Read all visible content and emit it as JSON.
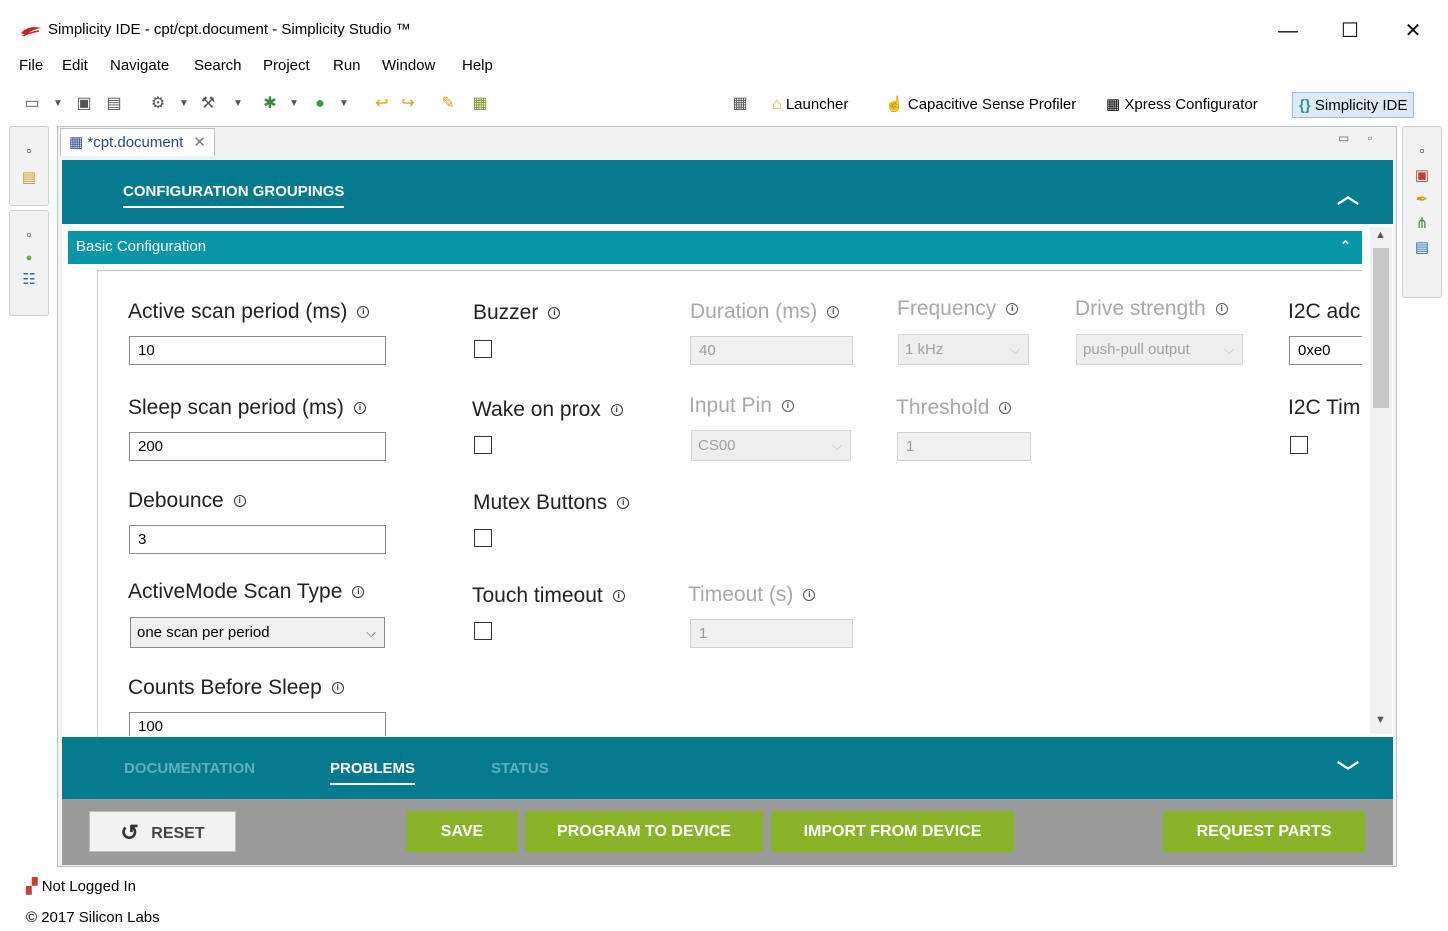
{
  "window": {
    "title": "Simplicity IDE - cpt/cpt.document - Simplicity Studio ™",
    "controls": {
      "minimize": "—",
      "maximize": "☐",
      "close": "✕"
    }
  },
  "menu": [
    "File",
    "Edit",
    "Navigate",
    "Search",
    "Project",
    "Run",
    "Window",
    "Help"
  ],
  "perspectives": {
    "launcher": "Launcher",
    "capsense": "Capacitive Sense Profiler",
    "xpress": "Xpress Configurator",
    "simplicity": "Simplicity IDE"
  },
  "editor": {
    "tab_label": "*cpt.document",
    "header_title": "CONFIGURATION GROUPINGS",
    "section_title": "Basic Configuration",
    "fields": {
      "active_scan_period": {
        "label": "Active scan period (ms)",
        "value": "10"
      },
      "sleep_scan_period": {
        "label": "Sleep scan period (ms)",
        "value": "200"
      },
      "debounce": {
        "label": "Debounce",
        "value": "3"
      },
      "activemode_scan_type": {
        "label": "ActiveMode Scan Type",
        "value": "one scan per period"
      },
      "counts_before_sleep": {
        "label": "Counts Before Sleep",
        "value": "100"
      },
      "buzzer": {
        "label": "Buzzer",
        "checked": false
      },
      "wake_on_prox": {
        "label": "Wake on prox",
        "checked": false
      },
      "mutex_buttons": {
        "label": "Mutex Buttons",
        "checked": false
      },
      "touch_timeout": {
        "label": "Touch timeout",
        "checked": false
      },
      "duration": {
        "label": "Duration (ms)",
        "value": "40"
      },
      "input_pin": {
        "label": "Input Pin",
        "value": "CS00"
      },
      "timeout": {
        "label": "Timeout (s)",
        "value": "1"
      },
      "frequency": {
        "label": "Frequency",
        "value": "1 kHz"
      },
      "threshold": {
        "label": "Threshold",
        "value": "1"
      },
      "drive_strength": {
        "label": "Drive strength",
        "value": "push-pull output"
      },
      "i2c_address": {
        "label": "I2C adc",
        "value": "0xe0"
      },
      "i2c_timeout": {
        "label": "I2C Tim",
        "checked": false
      }
    },
    "info_glyph": "i"
  },
  "footer_tabs": {
    "documentation": "DOCUMENTATION",
    "problems": "PROBLEMS",
    "status": "STATUS"
  },
  "actions": {
    "reset": "RESET",
    "save": "SAVE",
    "program": "PROGRAM TO DEVICE",
    "import": "IMPORT FROM DEVICE",
    "request": "REQUEST PARTS"
  },
  "status_bar": {
    "login": "Not Logged In",
    "copyright": "© 2017 Silicon Labs"
  },
  "colors": {
    "header_teal": "#057a8f",
    "section_teal": "#0795a8",
    "action_green": "#89b429",
    "action_bar_gray": "#9a9a9a"
  }
}
